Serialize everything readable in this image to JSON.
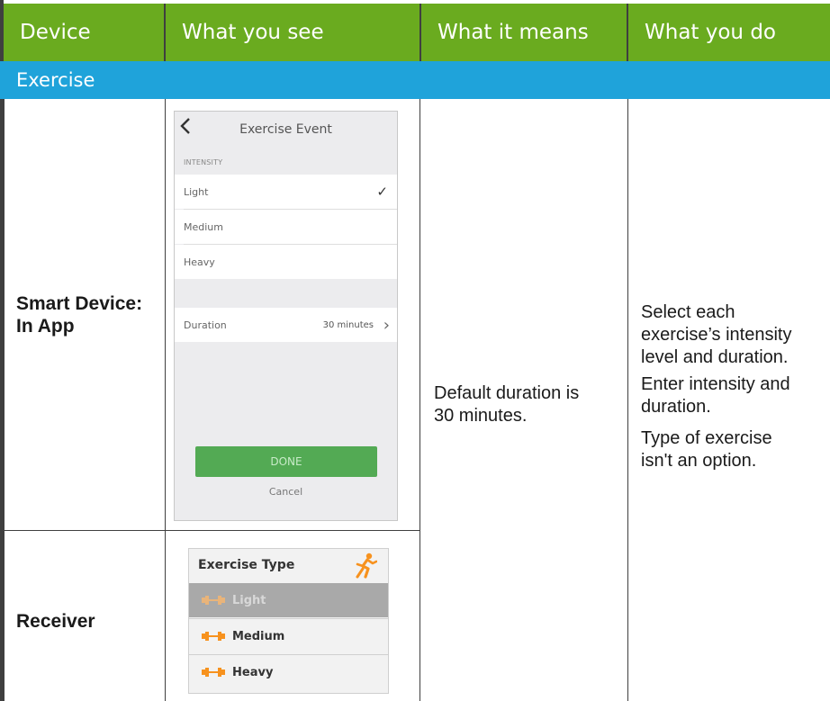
{
  "header": {
    "columns": [
      "Device",
      "What you see",
      "What it means",
      "What you do"
    ]
  },
  "section": {
    "title": "Exercise"
  },
  "rows": {
    "smart_device_label": [
      "Smart Device:",
      "In App"
    ],
    "receiver_label": "Receiver",
    "means": [
      "Default duration is",
      "30 minutes."
    ],
    "do": {
      "para1": [
        "Select each",
        "exercise’s intensity",
        "level and duration."
      ],
      "para2": [
        "Enter intensity and",
        "duration."
      ],
      "para3": [
        "Type of exercise",
        "isn't an option."
      ]
    }
  },
  "phone": {
    "back_icon": "chevron-left-icon",
    "title": "Exercise Event",
    "intensity_label": "INTENSITY",
    "options": [
      "Light",
      "Medium",
      "Heavy"
    ],
    "selected": "Light",
    "check": "✓",
    "duration_label": "Duration",
    "duration_value": "30 minutes",
    "chevron": "›",
    "done_label": "DONE",
    "cancel_label": "Cancel"
  },
  "receiver": {
    "title": "Exercise Type",
    "runner_icon": "runner-icon",
    "options": [
      "Light",
      "Medium",
      "Heavy"
    ],
    "selected": "Light",
    "colors": {
      "dumbbell": "#f7921e",
      "dumbbell_selected": "#e9b47a",
      "runner": "#f7921e"
    }
  },
  "colors": {
    "header": "#6aab1f",
    "section": "#1fa3da",
    "grid": "#3f3f3f"
  }
}
